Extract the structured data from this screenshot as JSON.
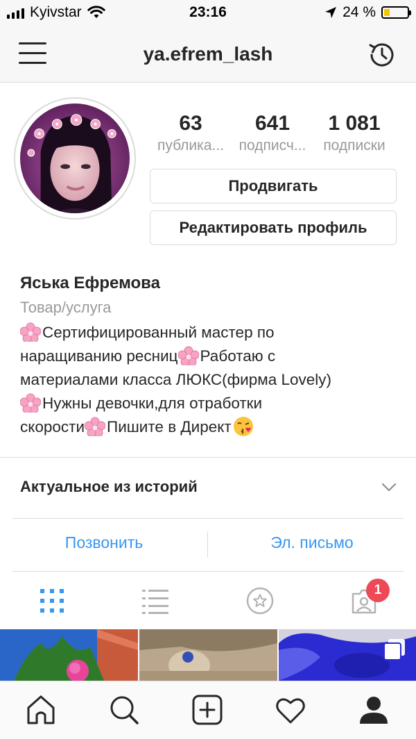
{
  "status_bar": {
    "carrier": "Kyivstar",
    "time": "23:16",
    "battery": "24 %",
    "battery_level": 0.24
  },
  "navbar": {
    "username": "ya.efrem_lash",
    "menu_icon": "hamburger-menu-icon",
    "history_icon": "archive-history-icon"
  },
  "profile": {
    "stats": [
      {
        "value": "63",
        "label": "публика..."
      },
      {
        "value": "641",
        "label": "подписч..."
      },
      {
        "value": "1 081",
        "label": "подписки"
      }
    ],
    "promote_button": "Продвигать",
    "edit_button": "Редактировать профиль",
    "name": "Яська Ефремова",
    "category": "Товар/услуга",
    "bio": {
      "line1": "Сертифицированный мастер по",
      "line2a": "наращиванию ресниц",
      "line2b": "Работаю с",
      "line3": "материалами класса ЛЮКС(фирма Lovely)",
      "line4": "Нужны девочки,для отработки",
      "line5a": "скорости",
      "line5b": "Пишите в Директ"
    }
  },
  "highlights": {
    "label": "Актуальное из историй"
  },
  "contact": {
    "call": "Позвонить",
    "email": "Эл. письмо"
  },
  "tabs": {
    "items": [
      "grid-view-icon",
      "list-view-icon",
      "saved-star-icon",
      "tagged-photos-icon"
    ],
    "tagged_badge": "1"
  },
  "bottom_nav": [
    "home-icon",
    "search-icon",
    "new-post-icon",
    "activity-heart-icon",
    "profile-icon"
  ],
  "colors": {
    "link": "#3897f0",
    "badge": "#ed4956",
    "text": "#262626",
    "secondary": "#999999",
    "border": "#dbdbdb"
  }
}
